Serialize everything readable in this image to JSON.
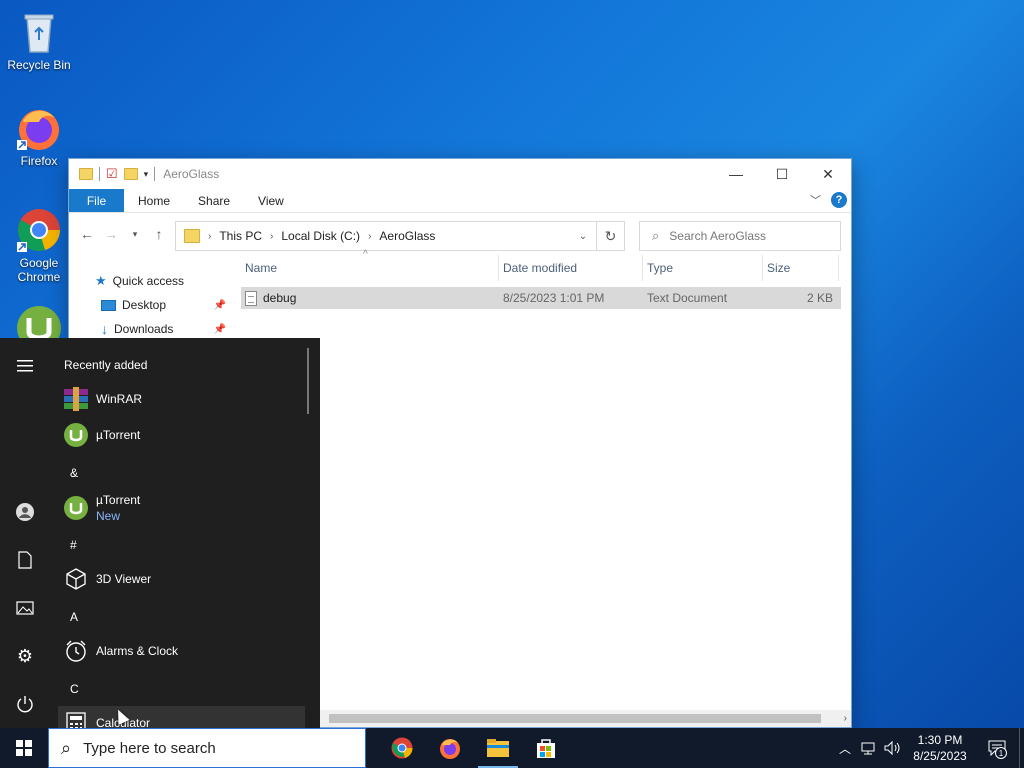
{
  "desktop": {
    "icons": [
      {
        "label": "Recycle Bin",
        "icon": "recycle-bin-icon"
      },
      {
        "label": "Firefox",
        "icon": "firefox-icon"
      },
      {
        "label": "Google Chrome",
        "icon": "chrome-icon"
      },
      {
        "label": "",
        "icon": "utorrent-icon"
      }
    ]
  },
  "explorer": {
    "title": "AeroGlass",
    "tabs": {
      "file": "File",
      "home": "Home",
      "share": "Share",
      "view": "View"
    },
    "breadcrumb": [
      "This PC",
      "Local Disk (C:)",
      "AeroGlass"
    ],
    "search_placeholder": "Search AeroGlass",
    "nav": {
      "quick_access": "Quick access",
      "desktop": "Desktop",
      "downloads": "Downloads"
    },
    "columns": {
      "name": "Name",
      "date": "Date modified",
      "type": "Type",
      "size": "Size"
    },
    "files": [
      {
        "name": "debug",
        "date": "8/25/2023 1:01 PM",
        "type": "Text Document",
        "size": "2 KB"
      }
    ]
  },
  "start_menu": {
    "recently_added": "Recently added",
    "apps": {
      "winrar": "WinRAR",
      "utorrent_recent": "µTorrent",
      "utorrent": "µTorrent",
      "utorrent_badge": "New",
      "viewer3d": "3D Viewer",
      "alarms": "Alarms & Clock",
      "calculator": "Calculator"
    },
    "letters": {
      "amp": "&",
      "hash": "#",
      "a": "A",
      "c": "C"
    }
  },
  "taskbar": {
    "search_placeholder": "Type here to search",
    "time": "1:30 PM",
    "date": "8/25/2023",
    "notification_count": "1"
  },
  "colors": {
    "accent": "#1979ca",
    "taskbar": "#101a2b",
    "start_bg": "#1f1f1f",
    "utorrent": "#76b041"
  }
}
